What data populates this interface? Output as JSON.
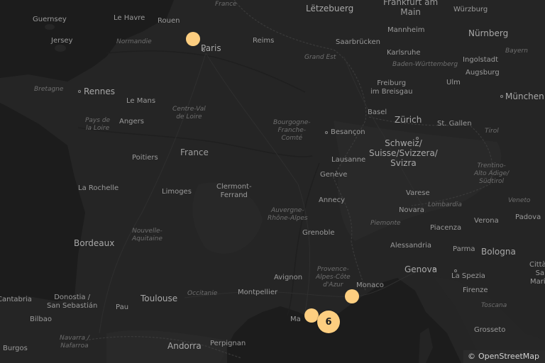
{
  "attribution": {
    "symbol": "©",
    "text": "OpenStreetMap"
  },
  "colors": {
    "marker": "#fdce80",
    "land": "#232323",
    "sea": "#1c1c1c",
    "label": "#8c8c8c"
  },
  "labels": {
    "guernsey": "Guernsey",
    "jersey": "Jersey",
    "le_havre": "Le Havre",
    "rouen": "Rouen",
    "france_top": "France",
    "normandie": "Normandie",
    "paris": "Paris",
    "reims": "Reims",
    "letzebuerg": "Lëtzebuerg",
    "frankfurt": "Frankfurt am\nMain",
    "wurzburg": "Würzburg",
    "mannheim": "Mannheim",
    "nurnberg": "Nürnberg",
    "saarbrucken": "Saarbrücken",
    "grand_est": "Grand Est",
    "karlsruhe": "Karlsruhe",
    "bayern": "Bayern",
    "ingolstadt": "Ingolstadt",
    "baden_wurttemberg": "Baden-Württemberg",
    "augsburg": "Augsburg",
    "bretagne": "Bretagne",
    "rennes": "Rennes",
    "freiburg": "Freiburg\nim Breisgau",
    "ulm": "Ulm",
    "munchen": "München",
    "le_mans": "Le Mans",
    "centre_val": "Centre-Val\nde Loire",
    "basel": "Basel",
    "zurich": "Zürich",
    "angers": "Angers",
    "pays_loire": "Pays de\nla Loire",
    "bourgogne": "Bourgogne-\nFranche-\nComté",
    "st_gallen": "St. Gallen",
    "tirol": "Tirol",
    "besancon": "Besançon",
    "schweiz": "Schweiz/\nSuisse/Svizzera/\nSvizra",
    "france": "France",
    "poitiers": "Poitiers",
    "trentino": "Trentino-\nAlto Adige/\nSüdtirol",
    "lausanne": "Lausanne",
    "geneve": "Genève",
    "la_rochelle": "La Rochelle",
    "limoges": "Limoges",
    "clermont": "Clermont-\nFerrand",
    "varese": "Varese",
    "annecy": "Annecy",
    "lombardia": "Lombardia",
    "veneto": "Veneto",
    "novara": "Novara",
    "auvergne": "Auvergne-\nRhône-Alpes",
    "verona": "Verona",
    "padova": "Padova",
    "nouvelle_aquitaine": "Nouvelle-\nAquitaine",
    "piemonte": "Piemonte",
    "piacenza": "Piacenza",
    "grenoble": "Grenoble",
    "bordeaux": "Bordeaux",
    "alessandria": "Alessandria",
    "parma": "Parma",
    "bologna": "Bologna",
    "provence": "Provence-\nAlpes-Côte\nd'Azur",
    "genova": "Genova",
    "citta_sm": "Città di\nSan\nMarino",
    "avignon": "Avignon",
    "la_spezia": "La Spezia",
    "monaco": "Monaco",
    "toulouse": "Toulouse",
    "occitanie": "Occitanie",
    "montpellier": "Montpellier",
    "firenze": "Firenze",
    "cantabria": "Cantabria",
    "donostia": "Donostia /\nSan Sebastián",
    "pau": "Pau",
    "marseille_partial": "Ma",
    "toscana": "Toscana",
    "bilbao": "Bilbao",
    "navarra": "Navarra /\nNafarroa",
    "perpignan": "Perpignan",
    "grosseto": "Grosseto",
    "burgos": "Burgos",
    "andorra": "Andorra"
  },
  "markers": [
    {
      "id": "paris",
      "type": "single",
      "count": null
    },
    {
      "id": "nice",
      "type": "single",
      "count": null
    },
    {
      "id": "marseille",
      "type": "single",
      "count": null
    },
    {
      "id": "toulon",
      "type": "cluster",
      "count": "6"
    }
  ]
}
